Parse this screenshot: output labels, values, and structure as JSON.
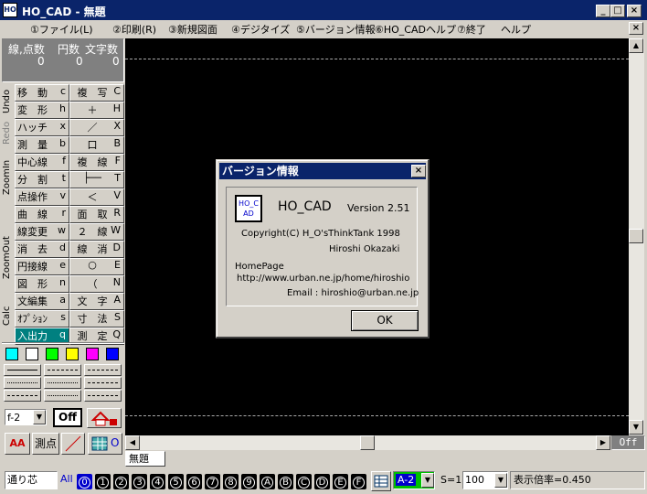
{
  "window": {
    "title": "HO_CAD - 無題",
    "icon_text": "HO"
  },
  "menu": [
    "①ファイル(L)",
    "②印刷(R)",
    "③新規図面",
    "④デジタイズ",
    "⑤バージョン情報",
    "⑥HO_CADヘルプ",
    "⑦終了",
    "ヘルプ"
  ],
  "stats": {
    "h1": "線,点数",
    "h2": "円数",
    "h3": "文字数",
    "v1": "0",
    "v2": "0",
    "v3": "0"
  },
  "side_tabs": [
    "Undo",
    "Redo",
    "ZoomIn",
    "ZoomOut",
    "Calc"
  ],
  "tools": [
    [
      "移　動",
      "c",
      "複　写",
      "C"
    ],
    [
      "変　形",
      "h",
      "＋",
      "H"
    ],
    [
      "ハッチ",
      "x",
      "／",
      "X"
    ],
    [
      "測　量",
      "b",
      "口",
      "B"
    ],
    [
      "中心線",
      "f",
      "複　線",
      "F"
    ],
    [
      "分　割",
      "t",
      "├──",
      "T"
    ],
    [
      "点操作",
      "v",
      "＜",
      "V"
    ],
    [
      "曲　線",
      "r",
      "面　取",
      "R"
    ],
    [
      "線変更",
      "w",
      "２　線",
      "W"
    ],
    [
      "消　去",
      "d",
      "線　消",
      "D"
    ],
    [
      "円接線",
      "e",
      "○",
      "E"
    ],
    [
      "図　形",
      "n",
      "（",
      "N"
    ],
    [
      "文編集",
      "a",
      "文　字",
      "A"
    ],
    [
      "ｵﾌﾟｼｮﾝ",
      "s",
      "寸　法",
      "S"
    ],
    [
      "入出力",
      "q",
      "測　定",
      "Q"
    ]
  ],
  "colors": [
    "#00ffff",
    "#ffffff",
    "#00ff00",
    "#ffff00",
    "#ff00ff",
    "#0000ff"
  ],
  "controls": {
    "line_type": "f-2",
    "off_label": "Off",
    "aa_label": "AA",
    "sokuten": "測点",
    "o_label": "O"
  },
  "doc_tab": "無題",
  "off_indicator": "Off",
  "dialog": {
    "title": "バージョン情報",
    "logo_text": "HO_CAD",
    "app_name": "HO_CAD",
    "version": "Version 2.51",
    "copyright": "Copyright(C) H_O'sThinkTank 1998",
    "author": "Hiroshi Okazaki",
    "homepage_label": "HomePage",
    "url": "http://www.urban.ne.jp/home/hiroshio",
    "email": "Email : hiroshio@urban.ne.jp",
    "ok": "OK"
  },
  "bottom": {
    "snap": "通り芯",
    "all": "All",
    "layers": [
      "0",
      "1",
      "2",
      "3",
      "4",
      "5",
      "6",
      "7",
      "8",
      "9",
      "A",
      "B",
      "C",
      "D",
      "E",
      "F"
    ],
    "paper": "A-2",
    "scale_label": "S=1:",
    "scale_value": "100",
    "zoom": "表示倍率=0.450"
  }
}
